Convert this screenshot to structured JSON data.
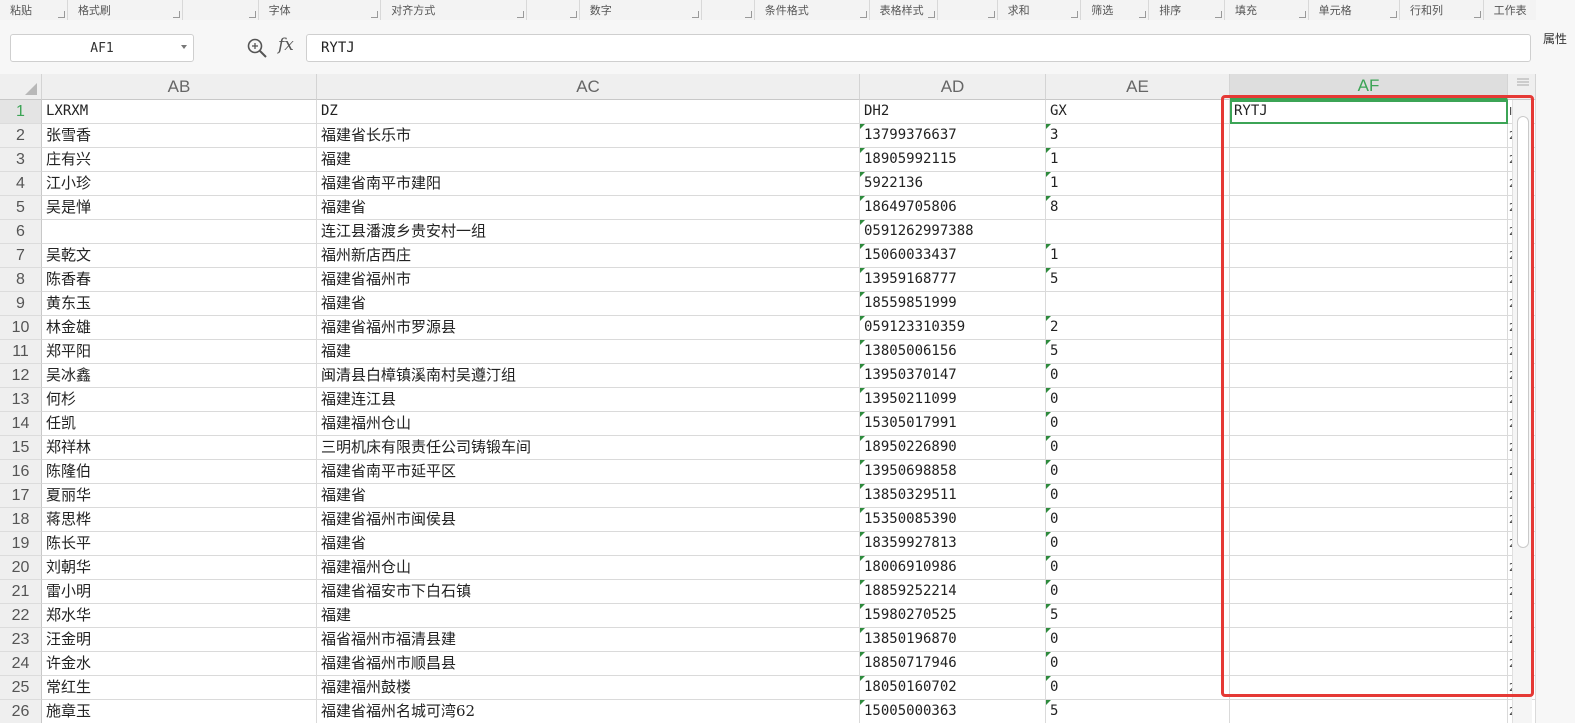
{
  "ribbon": {
    "groups": [
      "粘贴",
      "格式刷",
      "",
      "字体",
      "对齐方式",
      "",
      "数字",
      "",
      "条件格式",
      "表格样式",
      "",
      "求和",
      "筛选",
      "排序",
      "填充",
      "单元格",
      "行和列",
      "工作表"
    ]
  },
  "formula_bar": {
    "cell_ref": "AF1",
    "fx_label": "fx",
    "formula_value": "RYTJ"
  },
  "side_panel": {
    "label": "属性"
  },
  "columns": [
    {
      "id": "AB",
      "label": "AB"
    },
    {
      "id": "AC",
      "label": "AC"
    },
    {
      "id": "AD",
      "label": "AD"
    },
    {
      "id": "AE",
      "label": "AE"
    },
    {
      "id": "AF",
      "label": "AF",
      "active": true
    }
  ],
  "rows": [
    {
      "n": "1",
      "ab": "LXRXM",
      "ac": "DZ",
      "ad": "DH2",
      "ae": "GX",
      "af": "RYTJ",
      "edge": "I"
    },
    {
      "n": "2",
      "ab": "张雪香",
      "ac": "福建省长乐市",
      "ad": "13799376637",
      "ae": "3",
      "af": "",
      "edge": "2"
    },
    {
      "n": "3",
      "ab": "庄有兴",
      "ac": "福建",
      "ad": "18905992115",
      "ae": "1",
      "af": "",
      "edge": "2"
    },
    {
      "n": "4",
      "ab": "江小珍",
      "ac": "福建省南平市建阳",
      "ad": "5922136",
      "ae": "1",
      "af": "",
      "edge": "2"
    },
    {
      "n": "5",
      "ab": "吴是惮",
      "ac": "福建省",
      "ad": "18649705806",
      "ae": "8",
      "af": "",
      "edge": "2"
    },
    {
      "n": "6",
      "ab": "",
      "ac": "连江县潘渡乡贵安村一组",
      "ad": "0591262997388",
      "ae": "",
      "af": "",
      "edge": "2"
    },
    {
      "n": "7",
      "ab": "吴乾文",
      "ac": "福州新店西庄",
      "ad": "15060033437",
      "ae": "1",
      "af": "",
      "edge": "2"
    },
    {
      "n": "8",
      "ab": "陈香春",
      "ac": "福建省福州市",
      "ad": "13959168777",
      "ae": "5",
      "af": "",
      "edge": "2"
    },
    {
      "n": "9",
      "ab": "黄东玉",
      "ac": "福建省",
      "ad": "18559851999",
      "ae": "",
      "af": "",
      "edge": "2"
    },
    {
      "n": "10",
      "ab": "林金雄",
      "ac": "福建省福州市罗源县",
      "ad": "059123310359",
      "ae": "2",
      "af": "",
      "edge": "2"
    },
    {
      "n": "11",
      "ab": "郑平阳",
      "ac": "福建",
      "ad": "13805006156",
      "ae": "5",
      "af": "",
      "edge": "2"
    },
    {
      "n": "12",
      "ab": "吴冰鑫",
      "ac": "闽清县白樟镇溪南村吴遵汀组",
      "ad": "13950370147",
      "ae": "0",
      "af": "",
      "edge": "2"
    },
    {
      "n": "13",
      "ab": "何杉",
      "ac": "福建连江县",
      "ad": "13950211099",
      "ae": "0",
      "af": "",
      "edge": "2"
    },
    {
      "n": "14",
      "ab": "任凯",
      "ac": "福建福州仓山",
      "ad": "15305017991",
      "ae": "0",
      "af": "",
      "edge": "2"
    },
    {
      "n": "15",
      "ab": "郑祥林",
      "ac": "三明机床有限责任公司铸锻车间",
      "ad": "18950226890",
      "ae": "0",
      "af": "",
      "edge": "2"
    },
    {
      "n": "16",
      "ab": "陈隆伯",
      "ac": "福建省南平市延平区",
      "ad": "13950698858",
      "ae": "0",
      "af": "",
      "edge": "2"
    },
    {
      "n": "17",
      "ab": "夏丽华",
      "ac": "福建省",
      "ad": "13850329511",
      "ae": "0",
      "af": "",
      "edge": "2"
    },
    {
      "n": "18",
      "ab": "蒋思桦",
      "ac": "福建省福州市闽侯县",
      "ad": "15350085390",
      "ae": "0",
      "af": "",
      "edge": "2"
    },
    {
      "n": "19",
      "ab": "陈长平",
      "ac": "福建省",
      "ad": "18359927813",
      "ae": "0",
      "af": "",
      "edge": "2"
    },
    {
      "n": "20",
      "ab": "刘朝华",
      "ac": "福建福州仓山",
      "ad": "18006910986",
      "ae": "0",
      "af": "",
      "edge": "2"
    },
    {
      "n": "21",
      "ab": "雷小明",
      "ac": "福建省福安市下白石镇",
      "ad": "18859252214",
      "ae": "0",
      "af": "",
      "edge": "2"
    },
    {
      "n": "22",
      "ab": "郑水华",
      "ac": "福建",
      "ad": "15980270525",
      "ae": "5",
      "af": "",
      "edge": "2"
    },
    {
      "n": "23",
      "ab": "汪金明",
      "ac": "福省福州市福清县建",
      "ad": "13850196870",
      "ae": "0",
      "af": "",
      "edge": "2"
    },
    {
      "n": "24",
      "ab": "许金水",
      "ac": "福建省福州市顺昌县",
      "ad": "18850717946",
      "ae": "0",
      "af": "",
      "edge": "2"
    },
    {
      "n": "25",
      "ab": "常红生",
      "ac": "福建福州鼓楼",
      "ad": "18050160702",
      "ae": "0",
      "af": "",
      "edge": "2"
    },
    {
      "n": "26",
      "ab": "施章玉",
      "ac": "福建省福州名城可湾62",
      "ad": "15005000363",
      "ae": "5",
      "af": "",
      "edge": "2"
    }
  ],
  "colors": {
    "selection_green": "#3ca456",
    "annotation_red": "#e53935",
    "number_as_text_marker": "#2e8b3d"
  }
}
